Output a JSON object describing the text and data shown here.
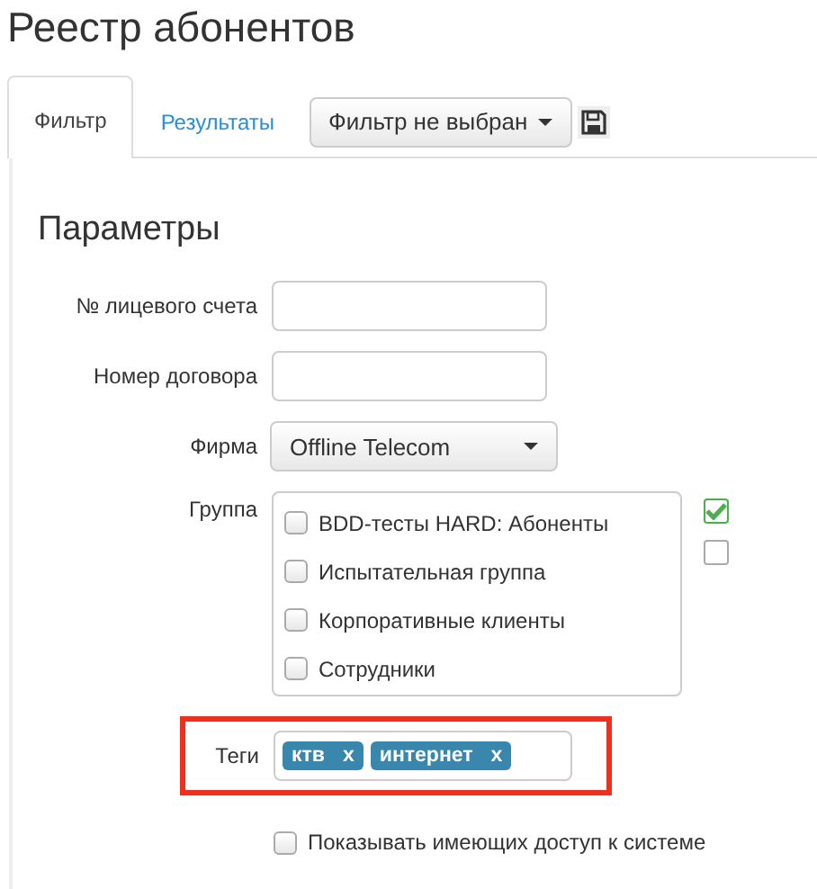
{
  "title": "Реестр абонентов",
  "tabs": [
    {
      "label": "Фильтр",
      "selected": true
    },
    {
      "label": "Результаты",
      "selected": false
    }
  ],
  "filter_select": {
    "value": "Фильтр не выбран"
  },
  "section_title": "Параметры",
  "fields": [
    {
      "label": "№ лицевого счета",
      "kind": "text"
    },
    {
      "label": "Номер договора",
      "kind": "text"
    },
    {
      "label": "Фирма",
      "kind": "select",
      "value": "Offline Telecom"
    }
  ],
  "group": {
    "label": "Группа",
    "items": [
      {
        "label": "BDD-тесты HARD: Абоненты",
        "checked": false
      },
      {
        "label": "Испытательная группа",
        "checked": false
      },
      {
        "label": "Корпоративные клиенты",
        "checked": false
      },
      {
        "label": "Сотрудники",
        "checked": false
      }
    ],
    "side_checks": [
      {
        "checked": true
      },
      {
        "checked": false
      }
    ]
  },
  "tags": {
    "label": "Теги",
    "highlighted": true,
    "items": [
      {
        "label": "ктв",
        "remove": "x"
      },
      {
        "label": "интернет",
        "remove": "x"
      }
    ]
  },
  "access_option": {
    "label": "Показывать имеющих доступ к системе",
    "checked": false
  }
}
